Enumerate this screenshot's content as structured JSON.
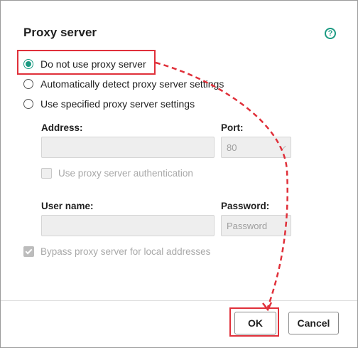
{
  "dialog": {
    "title": "Proxy server",
    "help_glyph": "?",
    "radio_options": [
      {
        "label": "Do not use proxy server",
        "checked": true
      },
      {
        "label": "Automatically detect proxy server settings",
        "checked": false
      },
      {
        "label": "Use specified proxy server settings",
        "checked": false
      }
    ],
    "address": {
      "label": "Address:",
      "value": ""
    },
    "port": {
      "label": "Port:",
      "value": "80"
    },
    "use_auth": {
      "label": "Use proxy server authentication",
      "checked": false
    },
    "username": {
      "label": "User name:",
      "value": ""
    },
    "password": {
      "label": "Password:",
      "placeholder": "Password"
    },
    "bypass": {
      "label": "Bypass proxy server for local addresses",
      "checked": true
    },
    "ok_label": "OK",
    "cancel_label": "Cancel"
  },
  "colors": {
    "accent": "#1b9a82",
    "annotation": "#e0303a"
  }
}
